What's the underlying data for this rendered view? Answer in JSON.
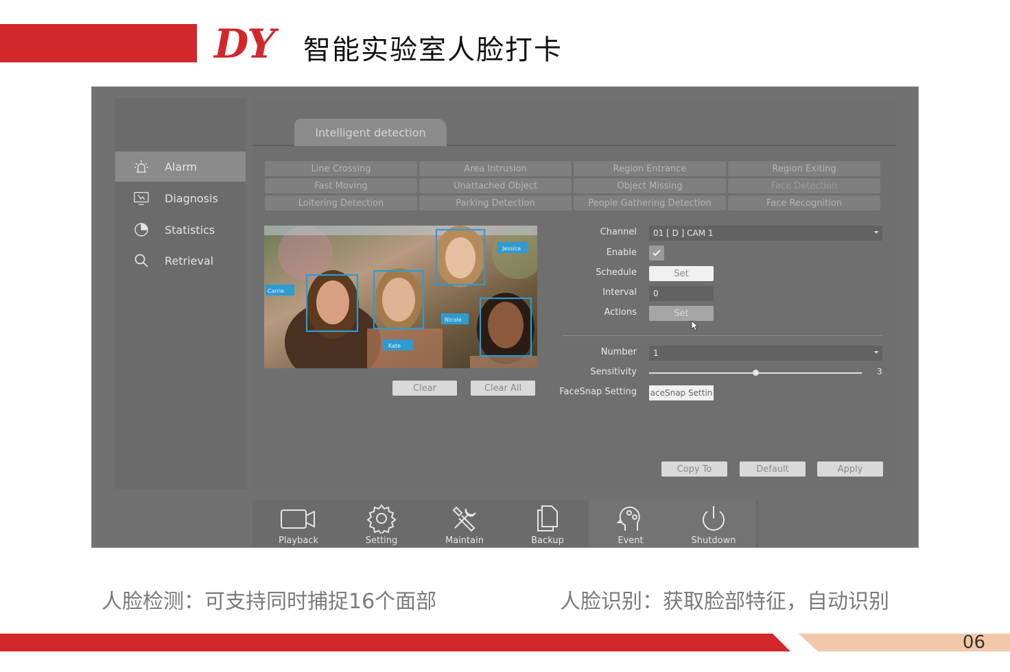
{
  "header": {
    "logo": "DY",
    "title": "智能实验室人脸打卡"
  },
  "app": {
    "tab": "Intelligent detection",
    "sidebar": [
      {
        "label": "Alarm",
        "icon": "alarm-icon",
        "active": true
      },
      {
        "label": "Diagnosis",
        "icon": "diagnosis-icon",
        "active": false
      },
      {
        "label": "Statistics",
        "icon": "statistics-icon",
        "active": false
      },
      {
        "label": "Retrieval",
        "icon": "search-icon",
        "active": false
      }
    ],
    "functions": [
      [
        "Line Crossing",
        "Area Intrusion",
        "Region Entrance",
        "Region Exiting"
      ],
      [
        "Fast Moving",
        "Unattached Object",
        "Object Missing",
        "Face Detection"
      ],
      [
        "Loitering Detection",
        "Parking Detection",
        "People Gathering Detection",
        "Face Recognition"
      ]
    ],
    "preview": {
      "names": [
        "Jessica",
        "Carrie",
        "Nicole",
        "Kate"
      ],
      "clear_label": "Clear",
      "clear_all_label": "Clear All"
    },
    "form": {
      "channel_label": "Channel",
      "channel_value": "01 [ D ] CAM 1",
      "enable_label": "Enable",
      "enable_checked": true,
      "schedule_label": "Schedule",
      "schedule_btn": "Set",
      "interval_label": "Interval",
      "interval_value": "0",
      "actions_label": "Actions",
      "actions_btn": "Set",
      "number_label": "Number",
      "number_value": "1",
      "sensitivity_label": "Sensitivity",
      "sensitivity_value": "3",
      "facesnap_label": "FaceSnap Setting",
      "facesnap_btn": "aceSnap Settin"
    },
    "actions": {
      "copy": "Copy To",
      "default": "Default",
      "apply": "Apply"
    },
    "dock": [
      {
        "label": "Playback",
        "icon": "video-camera-icon"
      },
      {
        "label": "Setting",
        "icon": "gear-icon"
      },
      {
        "label": "Maintain",
        "icon": "tools-icon"
      },
      {
        "label": "Backup",
        "icon": "copy-icon"
      },
      {
        "label": "Event",
        "icon": "head-gears-icon"
      },
      {
        "label": "Shutdown",
        "icon": "power-icon"
      }
    ]
  },
  "captions": {
    "left": "人脸检测：可支持同时捕捉16个面部",
    "right": "人脸识别：获取脸部特征，自动识别"
  },
  "footer": {
    "page_number": "06"
  },
  "colors": {
    "brand_red": "#d3272b",
    "peach": "#f3c8a8",
    "ui_gray": "#717171",
    "face_box": "#2e9bd1"
  }
}
